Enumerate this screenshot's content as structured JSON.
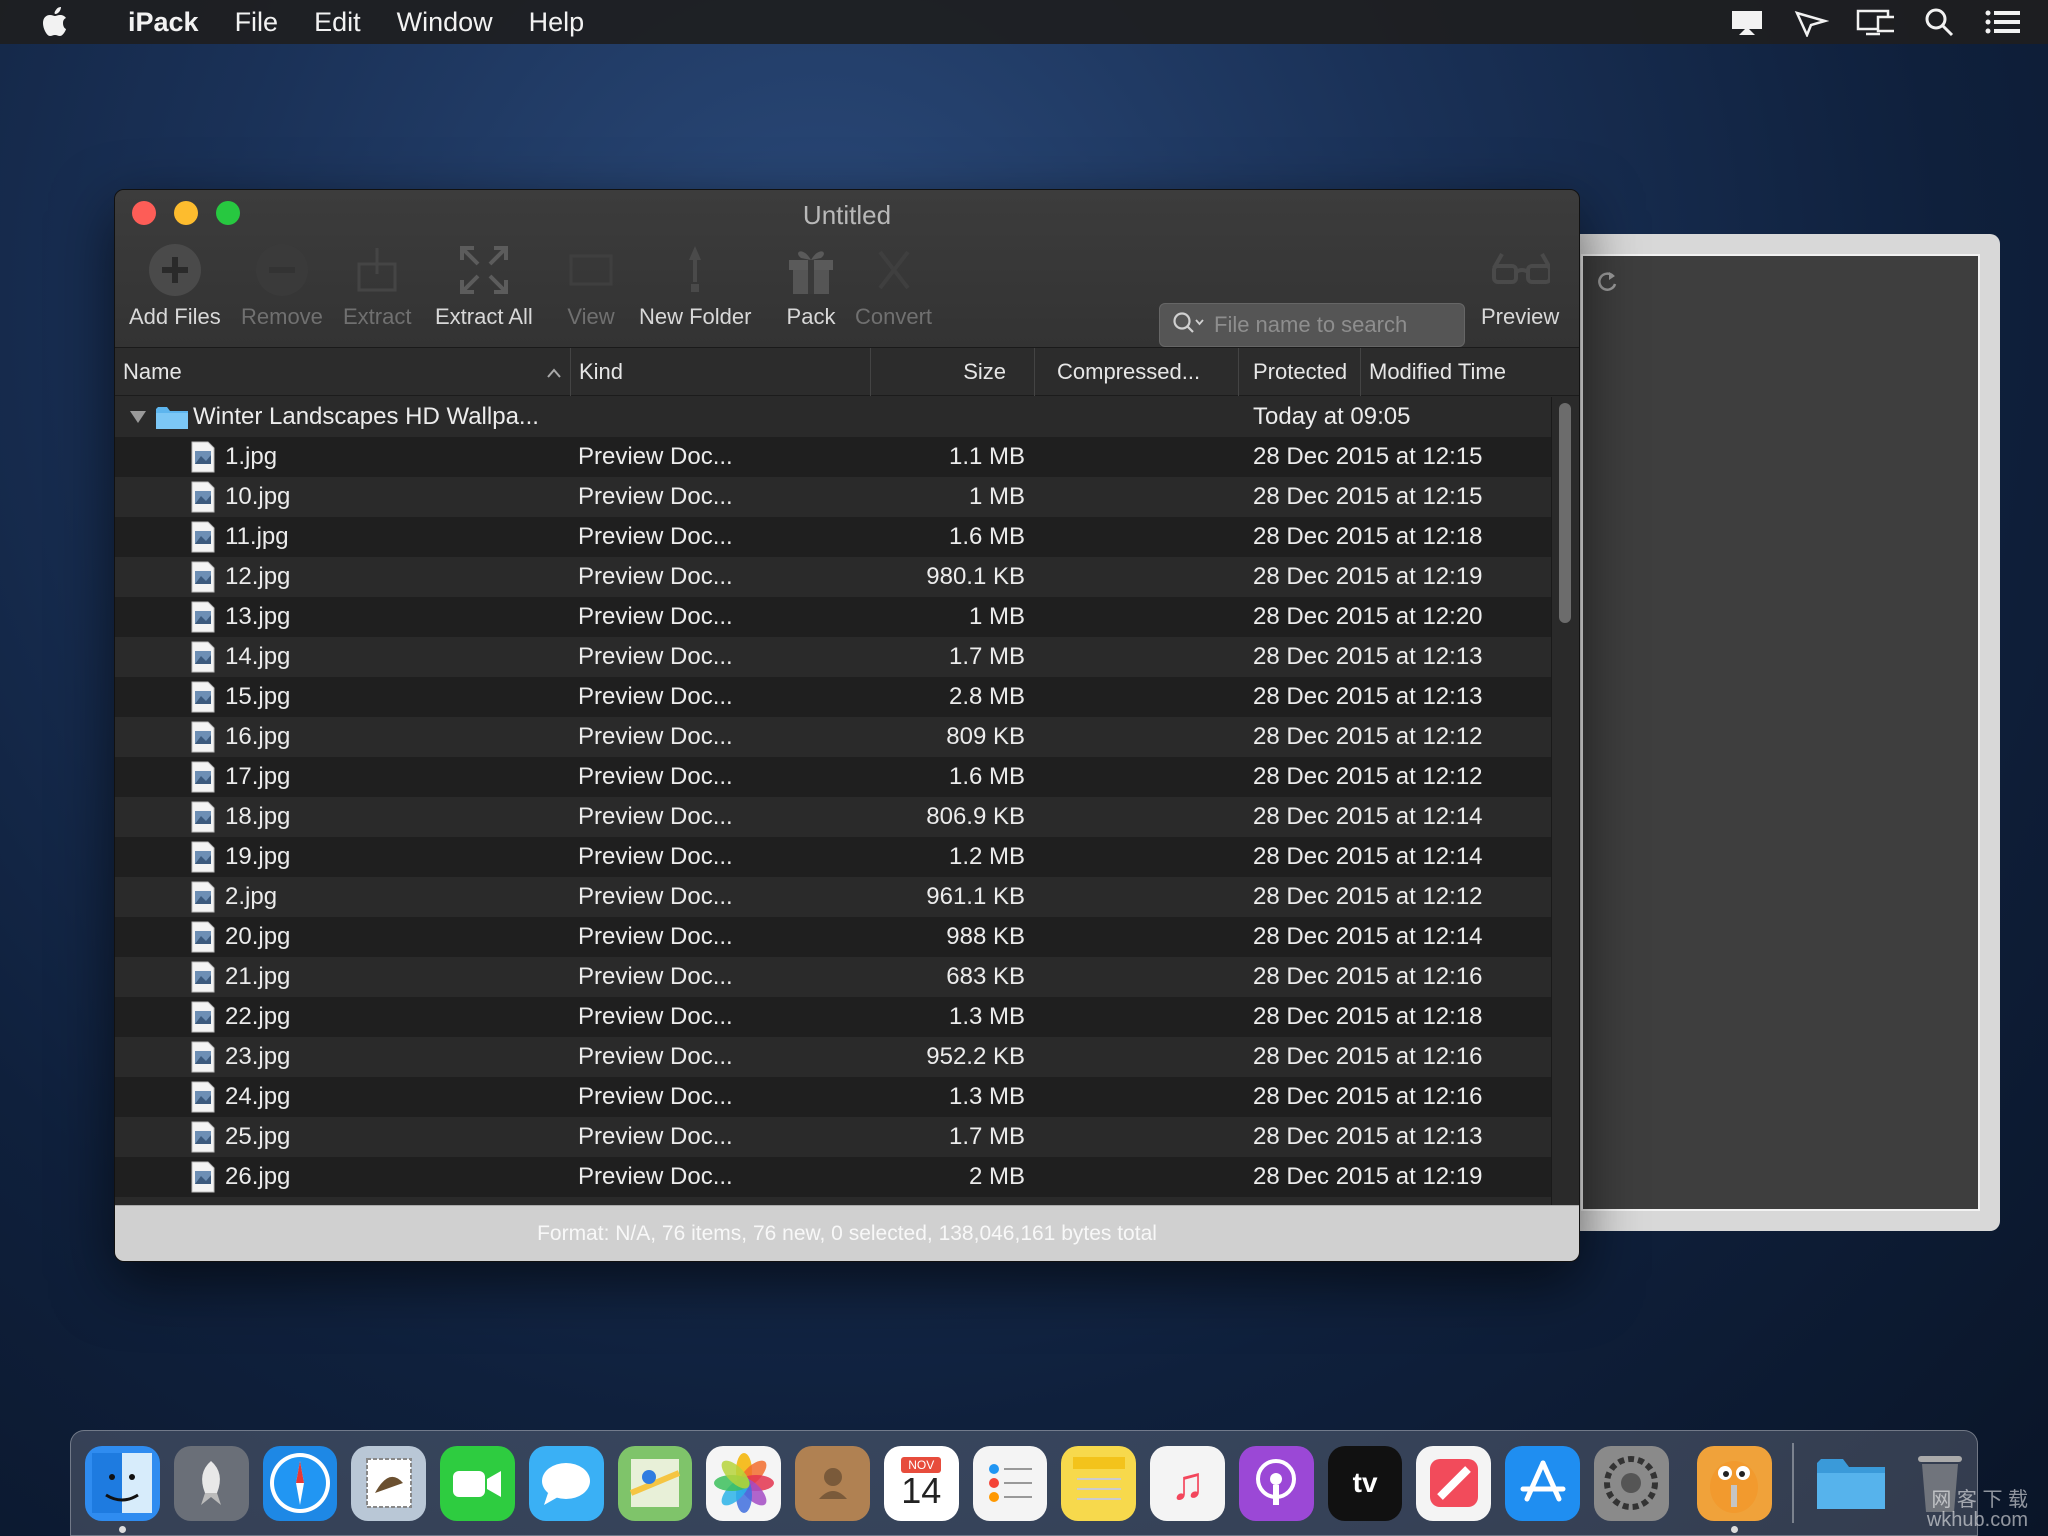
{
  "menubar": {
    "app_name": "iPack",
    "items": [
      "File",
      "Edit",
      "Window",
      "Help"
    ]
  },
  "window": {
    "title": "Untitled",
    "toolbar": [
      {
        "label": "Add Files",
        "enabled": true,
        "icon": "plus-circle-icon"
      },
      {
        "label": "Remove",
        "enabled": false,
        "icon": "minus-circle-icon"
      },
      {
        "label": "Extract",
        "enabled": false,
        "icon": "extract-icon"
      },
      {
        "label": "Extract All",
        "enabled": true,
        "icon": "expand-arrows-icon"
      },
      {
        "label": "View",
        "enabled": false,
        "icon": "view-icon"
      },
      {
        "label": "New Folder",
        "enabled": true,
        "icon": "new-folder-icon"
      },
      {
        "label": "Pack",
        "enabled": true,
        "icon": "gift-box-icon"
      },
      {
        "label": "Convert",
        "enabled": false,
        "icon": "convert-icon"
      },
      {
        "label": "Preview",
        "enabled": true,
        "icon": "glasses-icon"
      }
    ],
    "search": {
      "placeholder": "File name to search",
      "value": ""
    },
    "columns": {
      "name": "Name",
      "kind": "Kind",
      "size": "Size",
      "compressed": "Compressed...",
      "protected": "Protected",
      "modified": "Modified Time"
    },
    "folder": {
      "name": "Winter Landscapes HD Wallpa...",
      "modified": "Today at 09:05"
    },
    "files": [
      {
        "name": "1.jpg",
        "kind": "Preview Doc...",
        "size": "1.1 MB",
        "modified": "28 Dec 2015 at 12:15"
      },
      {
        "name": "10.jpg",
        "kind": "Preview Doc...",
        "size": "1 MB",
        "modified": "28 Dec 2015 at 12:15"
      },
      {
        "name": "11.jpg",
        "kind": "Preview Doc...",
        "size": "1.6 MB",
        "modified": "28 Dec 2015 at 12:18"
      },
      {
        "name": "12.jpg",
        "kind": "Preview Doc...",
        "size": "980.1 KB",
        "modified": "28 Dec 2015 at 12:19"
      },
      {
        "name": "13.jpg",
        "kind": "Preview Doc...",
        "size": "1 MB",
        "modified": "28 Dec 2015 at 12:20"
      },
      {
        "name": "14.jpg",
        "kind": "Preview Doc...",
        "size": "1.7 MB",
        "modified": "28 Dec 2015 at 12:13"
      },
      {
        "name": "15.jpg",
        "kind": "Preview Doc...",
        "size": "2.8 MB",
        "modified": "28 Dec 2015 at 12:13"
      },
      {
        "name": "16.jpg",
        "kind": "Preview Doc...",
        "size": "809 KB",
        "modified": "28 Dec 2015 at 12:12"
      },
      {
        "name": "17.jpg",
        "kind": "Preview Doc...",
        "size": "1.6 MB",
        "modified": "28 Dec 2015 at 12:12"
      },
      {
        "name": "18.jpg",
        "kind": "Preview Doc...",
        "size": "806.9 KB",
        "modified": "28 Dec 2015 at 12:14"
      },
      {
        "name": "19.jpg",
        "kind": "Preview Doc...",
        "size": "1.2 MB",
        "modified": "28 Dec 2015 at 12:14"
      },
      {
        "name": "2.jpg",
        "kind": "Preview Doc...",
        "size": "961.1 KB",
        "modified": "28 Dec 2015 at 12:12"
      },
      {
        "name": "20.jpg",
        "kind": "Preview Doc...",
        "size": "988 KB",
        "modified": "28 Dec 2015 at 12:14"
      },
      {
        "name": "21.jpg",
        "kind": "Preview Doc...",
        "size": "683 KB",
        "modified": "28 Dec 2015 at 12:16"
      },
      {
        "name": "22.jpg",
        "kind": "Preview Doc...",
        "size": "1.3 MB",
        "modified": "28 Dec 2015 at 12:18"
      },
      {
        "name": "23.jpg",
        "kind": "Preview Doc...",
        "size": "952.2 KB",
        "modified": "28 Dec 2015 at 12:16"
      },
      {
        "name": "24.jpg",
        "kind": "Preview Doc...",
        "size": "1.3 MB",
        "modified": "28 Dec 2015 at 12:16"
      },
      {
        "name": "25.jpg",
        "kind": "Preview Doc...",
        "size": "1.7 MB",
        "modified": "28 Dec 2015 at 12:13"
      },
      {
        "name": "26.jpg",
        "kind": "Preview Doc...",
        "size": "2 MB",
        "modified": "28 Dec 2015 at 12:19"
      }
    ],
    "status": "Format: N/A, 76 items, 76 new, 0 selected, 138,046,161 bytes total"
  },
  "dock": {
    "apps": [
      {
        "name": "finder-icon",
        "color": "#2f8cf0"
      },
      {
        "name": "launchpad-icon",
        "color": "#6a6f78"
      },
      {
        "name": "safari-icon",
        "color": "#1e88e5"
      },
      {
        "name": "mail-icon",
        "color": "#b9c7d6"
      },
      {
        "name": "facetime-icon",
        "color": "#2ecc40"
      },
      {
        "name": "messages-icon",
        "color": "#3ab0f5"
      },
      {
        "name": "maps-icon",
        "color": "#7fc46a"
      },
      {
        "name": "photos-icon",
        "color": "#f5f5f5"
      },
      {
        "name": "contacts-icon",
        "color": "#b08152"
      },
      {
        "name": "calendar-icon",
        "color": "#ffffff"
      },
      {
        "name": "reminders-icon",
        "color": "#f4f4f4"
      },
      {
        "name": "notes-icon",
        "color": "#f7d94c"
      },
      {
        "name": "music-icon",
        "color": "#f4f4f4"
      },
      {
        "name": "podcasts-icon",
        "color": "#9b48d6"
      },
      {
        "name": "apple-tv-icon",
        "color": "#111111"
      },
      {
        "name": "news-icon",
        "color": "#f4f4f4"
      },
      {
        "name": "app-store-icon",
        "color": "#1f8ef1"
      },
      {
        "name": "system-preferences-icon",
        "color": "#8a8a8a"
      },
      {
        "name": "ipack-icon",
        "color": "#f0a23a"
      }
    ],
    "calendar": {
      "month": "NOV",
      "day": "14"
    },
    "tv_label": "tv"
  },
  "watermark": {
    "line1": "网 客 下 载",
    "line2": "wkhub.com"
  }
}
